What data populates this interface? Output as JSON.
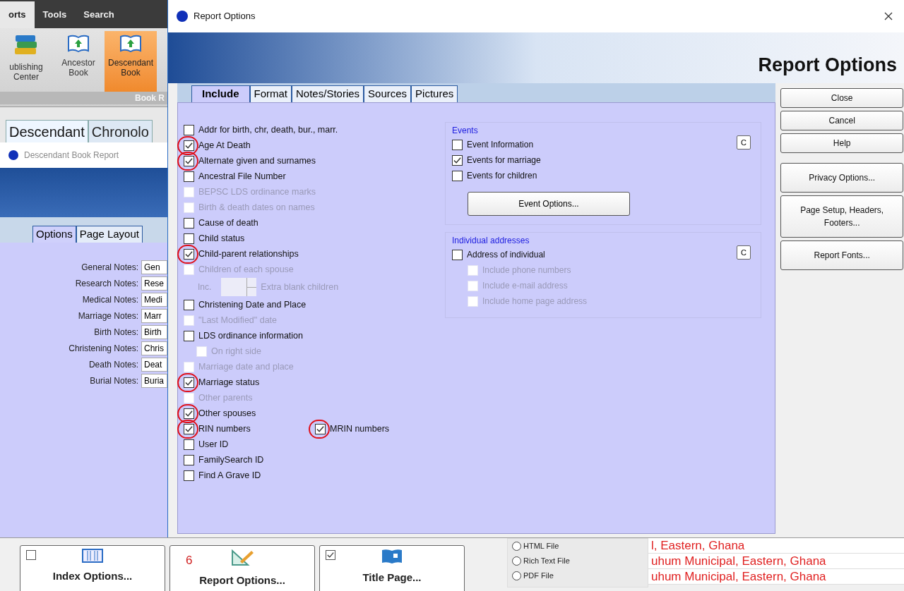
{
  "app": {
    "ribbon_tabs": [
      {
        "label": "orts",
        "selected": true
      },
      {
        "label": "Tools",
        "selected": false
      },
      {
        "label": "Search",
        "selected": false
      }
    ],
    "ribbon_buttons": [
      {
        "lines": [
          "ublishing",
          "Center"
        ],
        "selected": false
      },
      {
        "lines": [
          "Ancestor",
          "Book"
        ],
        "selected": false
      },
      {
        "lines": [
          "Descendant",
          "Book"
        ],
        "selected": true
      }
    ],
    "ribbon_group": "Book R",
    "report_tabs": [
      {
        "label": "Descendant",
        "selected": true
      },
      {
        "label": "Chronolo",
        "selected": false
      }
    ],
    "report_title": "Descendant Book Report",
    "option_tabs": [
      {
        "label": "Options",
        "selected": true
      },
      {
        "label": "Page Layout",
        "selected": false
      }
    ],
    "notes": [
      {
        "label": "General Notes:",
        "value": "Gen"
      },
      {
        "label": "Research Notes:",
        "value": "Rese"
      },
      {
        "label": "Medical Notes:",
        "value": "Medi"
      },
      {
        "label": "Marriage Notes:",
        "value": "Marr"
      },
      {
        "label": "Birth Notes:",
        "value": "Birth"
      },
      {
        "label": "Christening Notes:",
        "value": "Chris"
      },
      {
        "label": "Death Notes:",
        "value": "Deat"
      },
      {
        "label": "Burial Notes:",
        "value": "Buria"
      }
    ],
    "bottom_buttons": [
      {
        "label": "Index Options...",
        "kind": "checkbox",
        "checked": false
      },
      {
        "label": "Report Options...",
        "kind": "number",
        "number": "6"
      },
      {
        "label": "Title Page...",
        "kind": "checkbox",
        "checked": true
      }
    ],
    "output_formats": [
      {
        "label": "HTML File",
        "selected": false
      },
      {
        "label": "Rich Text File",
        "selected": false
      },
      {
        "label": "PDF File",
        "selected": false
      }
    ],
    "places": [
      "l, Eastern, Ghana",
      "uhum Municipal, Eastern, Ghana",
      "uhum Municipal, Eastern, Ghana"
    ]
  },
  "dialog": {
    "title": "Report Options",
    "heading": "Report Options",
    "tabs": [
      {
        "label": "Include",
        "selected": true
      },
      {
        "label": "Format",
        "selected": false
      },
      {
        "label": "Notes/Stories",
        "selected": false
      },
      {
        "label": "Sources",
        "selected": false
      },
      {
        "label": "Pictures",
        "selected": false
      }
    ],
    "include_items": [
      {
        "kind": "checkbox",
        "label": "Addr for birth, chr, death, bur., marr.",
        "checked": false,
        "disabled": false,
        "highlighted": false
      },
      {
        "kind": "checkbox",
        "label": "Age At Death",
        "checked": true,
        "disabled": false,
        "highlighted": true
      },
      {
        "kind": "checkbox",
        "label": "Alternate given and surnames",
        "checked": true,
        "disabled": false,
        "highlighted": true
      },
      {
        "kind": "checkbox",
        "label": "Ancestral File Number",
        "checked": false,
        "disabled": false,
        "highlighted": false
      },
      {
        "kind": "checkbox",
        "label": "BEPSC LDS ordinance marks",
        "checked": false,
        "disabled": true,
        "highlighted": false
      },
      {
        "kind": "checkbox",
        "label": "Birth & death dates on names",
        "checked": false,
        "disabled": true,
        "highlighted": false
      },
      {
        "kind": "checkbox",
        "label": "Cause of death",
        "checked": false,
        "disabled": false,
        "highlighted": false
      },
      {
        "kind": "checkbox",
        "label": "Child status",
        "checked": false,
        "disabled": false,
        "highlighted": false
      },
      {
        "kind": "checkbox",
        "label": "Child-parent relationships",
        "checked": true,
        "disabled": false,
        "highlighted": true
      },
      {
        "kind": "checkbox",
        "label": "Children of each spouse",
        "checked": false,
        "disabled": true,
        "highlighted": false
      },
      {
        "kind": "spinner",
        "label": "Inc.",
        "suffix": "Extra blank children",
        "disabled": true
      },
      {
        "kind": "checkbox",
        "label": "Christening Date and Place",
        "checked": false,
        "disabled": false,
        "highlighted": false
      },
      {
        "kind": "checkbox",
        "label": "\"Last Modified\" date",
        "checked": false,
        "disabled": true,
        "highlighted": false
      },
      {
        "kind": "checkbox",
        "label": "LDS ordinance information",
        "checked": false,
        "disabled": false,
        "highlighted": false,
        "children": [
          {
            "label": "On right side",
            "checked": false,
            "disabled": true,
            "highlighted": false
          }
        ]
      },
      {
        "kind": "checkbox",
        "label": "Marriage date and place",
        "checked": false,
        "disabled": true,
        "highlighted": false
      },
      {
        "kind": "checkbox",
        "label": "Marriage status",
        "checked": true,
        "disabled": false,
        "highlighted": true
      },
      {
        "kind": "checkbox",
        "label": "Other parents",
        "checked": false,
        "disabled": true,
        "highlighted": false
      },
      {
        "kind": "checkbox",
        "label": "Other spouses",
        "checked": true,
        "disabled": false,
        "highlighted": true
      },
      {
        "kind": "checkbox",
        "label": "RIN numbers",
        "checked": true,
        "disabled": false,
        "highlighted": true,
        "companion": {
          "label": "MRIN numbers",
          "checked": true,
          "disabled": false,
          "highlighted": true
        }
      },
      {
        "kind": "checkbox",
        "label": "User ID",
        "checked": false,
        "disabled": false,
        "highlighted": false
      },
      {
        "kind": "checkbox",
        "label": "FamilySearch ID",
        "checked": false,
        "disabled": false,
        "highlighted": false
      },
      {
        "kind": "checkbox",
        "label": "Find A Grave ID",
        "checked": false,
        "disabled": false,
        "highlighted": false
      }
    ],
    "groups": [
      {
        "title": "Events",
        "clear_button": "C",
        "items": [
          {
            "label": "Event Information",
            "checked": false,
            "disabled": false
          },
          {
            "label": "Events for marriage",
            "checked": true,
            "disabled": false
          },
          {
            "label": "Events for children",
            "checked": false,
            "disabled": false
          }
        ],
        "button": "Event Options..."
      },
      {
        "title": "Individual addresses",
        "clear_button": "C",
        "items": [
          {
            "label": "Address of individual",
            "checked": false,
            "disabled": false,
            "children": [
              {
                "label": "Include phone numbers",
                "checked": false,
                "disabled": true
              },
              {
                "label": "Include e-mail address",
                "checked": false,
                "disabled": true
              },
              {
                "label": "Include home page address",
                "checked": false,
                "disabled": true
              }
            ]
          }
        ]
      }
    ],
    "side_buttons": [
      "Close",
      "Cancel",
      "Help",
      "Privacy Options...",
      "Page Setup, Headers, Footers...",
      "Report Fonts..."
    ]
  }
}
